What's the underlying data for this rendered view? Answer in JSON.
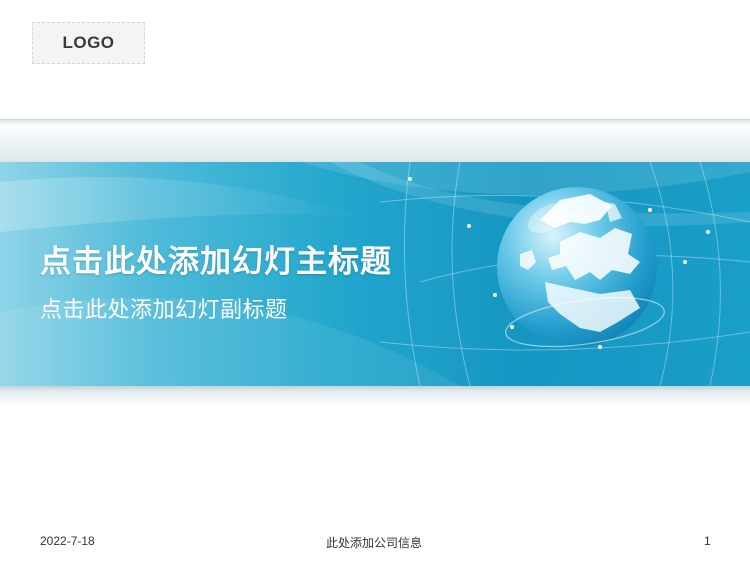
{
  "logo": {
    "text": "LOGO"
  },
  "slide": {
    "title": "点击此处添加幻灯主标题",
    "subtitle": "点击此处添加幻灯副标题"
  },
  "footer": {
    "date": "2022-7-18",
    "company": "此处添加公司信息",
    "page_number": "1"
  },
  "colors": {
    "banner_light": "#8fd4e8",
    "banner_mid": "#23a7cd",
    "banner_dark": "#1596c2",
    "globe_highlight": "#e8f8fd",
    "globe_shadow": "#0d7fae"
  },
  "icons": {
    "globe": "globe-icon"
  }
}
